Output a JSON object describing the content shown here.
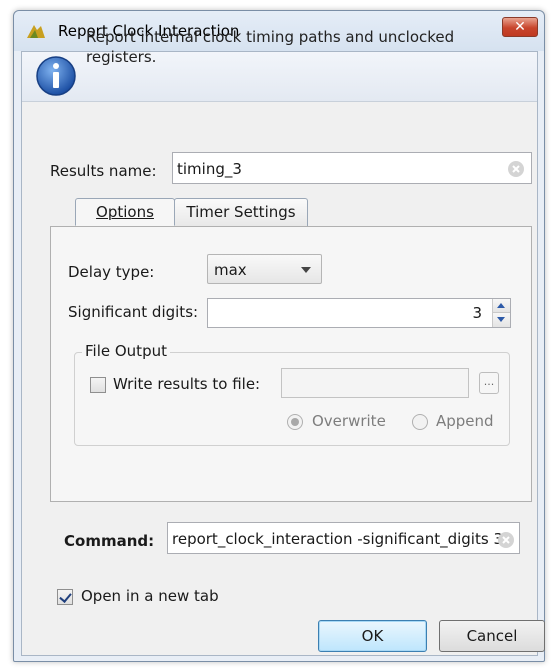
{
  "window": {
    "title": "Report Clock Interaction",
    "close_label": "✕"
  },
  "header": {
    "description": "Report internal clock timing paths and unclocked registers."
  },
  "results": {
    "label": "Results name:",
    "value": "timing_3"
  },
  "tabs": [
    {
      "label": "Options",
      "active": true
    },
    {
      "label": "Timer Settings",
      "active": false
    }
  ],
  "options": {
    "delay_type_label": "Delay type:",
    "delay_type_value": "max",
    "significant_digits_label": "Significant digits:",
    "significant_digits_value": "3",
    "file_output": {
      "group_label": "File Output",
      "write_label": "Write results to file:",
      "write_checked": false,
      "file_path": "",
      "browse_label": "...",
      "overwrite_label": "Overwrite",
      "overwrite_selected": true,
      "append_label": "Append",
      "append_selected": false
    }
  },
  "command": {
    "label": "Command:",
    "value": "report_clock_interaction -significant_digits 3"
  },
  "open_new_tab": {
    "label": "Open in a new tab",
    "checked": true
  },
  "buttons": {
    "ok": "OK",
    "cancel": "Cancel"
  },
  "colors": {
    "accent": "#3c7fb1",
    "close_button": "#c8452d",
    "info_icon": "#2a62b8"
  },
  "icons": {
    "app": "vivado-leaf-icon",
    "info": "info-icon",
    "clear": "clear-icon",
    "close": "close-icon"
  }
}
